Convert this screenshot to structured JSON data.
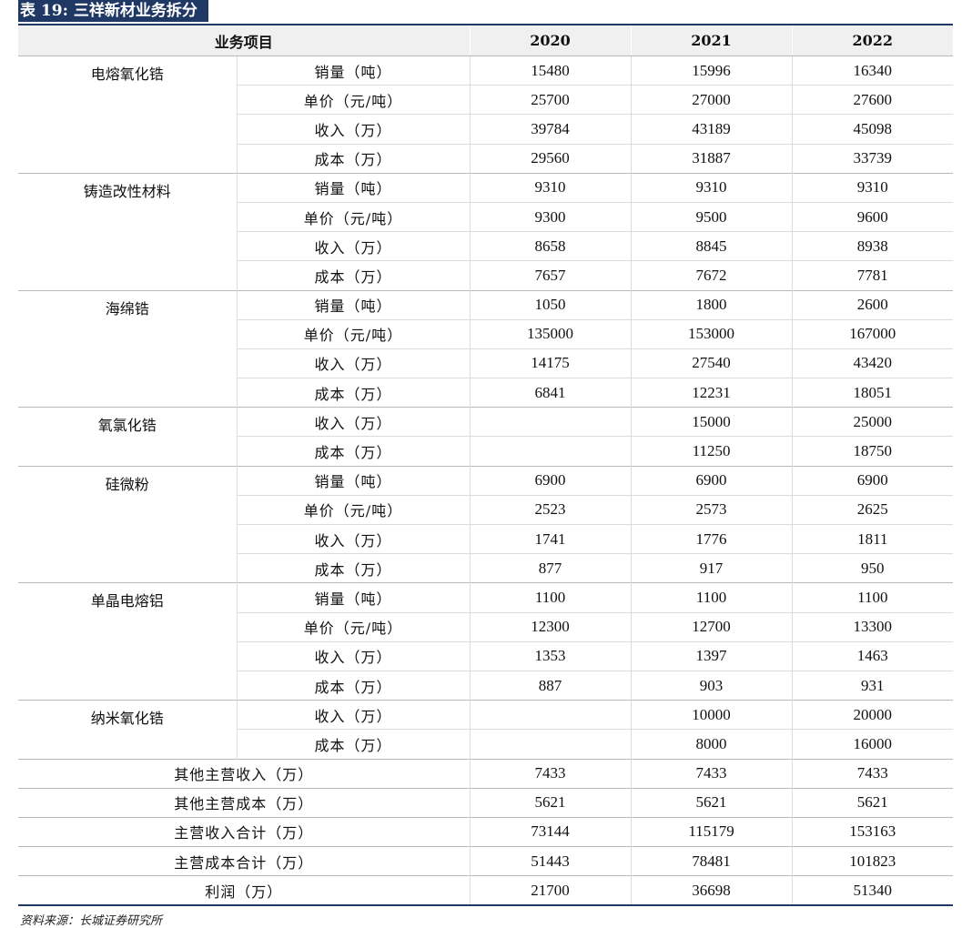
{
  "title": {
    "label": "表 19:",
    "text": "三祥新材业务拆分"
  },
  "header": [
    "业务项目",
    "2020",
    "2021",
    "2022"
  ],
  "groups": [
    {
      "name": "电熔氧化锆",
      "rows": [
        {
          "metric": "销量（吨）",
          "values": [
            "15480",
            "15996",
            "16340"
          ]
        },
        {
          "metric": "单价（元/吨）",
          "values": [
            "25700",
            "27000",
            "27600"
          ]
        },
        {
          "metric": "收入（万）",
          "values": [
            "39784",
            "43189",
            "45098"
          ]
        },
        {
          "metric": "成本（万）",
          "values": [
            "29560",
            "31887",
            "33739"
          ]
        }
      ]
    },
    {
      "name": "铸造改性材料",
      "rows": [
        {
          "metric": "销量（吨）",
          "values": [
            "9310",
            "9310",
            "9310"
          ]
        },
        {
          "metric": "单价（元/吨）",
          "values": [
            "9300",
            "9500",
            "9600"
          ]
        },
        {
          "metric": "收入（万）",
          "values": [
            "8658",
            "8845",
            "8938"
          ]
        },
        {
          "metric": "成本（万）",
          "values": [
            "7657",
            "7672",
            "7781"
          ]
        }
      ]
    },
    {
      "name": "海绵锆",
      "rows": [
        {
          "metric": "销量（吨）",
          "values": [
            "1050",
            "1800",
            "2600"
          ]
        },
        {
          "metric": "单价（元/吨）",
          "values": [
            "135000",
            "153000",
            "167000"
          ]
        },
        {
          "metric": "收入（万）",
          "values": [
            "14175",
            "27540",
            "43420"
          ]
        },
        {
          "metric": "成本（万）",
          "values": [
            "6841",
            "12231",
            "18051"
          ]
        }
      ]
    },
    {
      "name": "氧氯化锆",
      "rows": [
        {
          "metric": "收入（万）",
          "values": [
            "",
            "15000",
            "25000"
          ]
        },
        {
          "metric": "成本（万）",
          "values": [
            "",
            "11250",
            "18750"
          ]
        }
      ]
    },
    {
      "name": "硅微粉",
      "rows": [
        {
          "metric": "销量（吨）",
          "values": [
            "6900",
            "6900",
            "6900"
          ]
        },
        {
          "metric": "单价（元/吨）",
          "values": [
            "2523",
            "2573",
            "2625"
          ]
        },
        {
          "metric": "收入（万）",
          "values": [
            "1741",
            "1776",
            "1811"
          ]
        },
        {
          "metric": "成本（万）",
          "values": [
            "877",
            "917",
            "950"
          ]
        }
      ]
    },
    {
      "name": "单晶电熔铝",
      "rows": [
        {
          "metric": "销量（吨）",
          "values": [
            "1100",
            "1100",
            "1100"
          ]
        },
        {
          "metric": "单价（元/吨）",
          "values": [
            "12300",
            "12700",
            "13300"
          ]
        },
        {
          "metric": "收入（万）",
          "values": [
            "1353",
            "1397",
            "1463"
          ]
        },
        {
          "metric": "成本（万）",
          "values": [
            "887",
            "903",
            "931"
          ]
        }
      ]
    },
    {
      "name": "纳米氧化锆",
      "rows": [
        {
          "metric": "收入（万）",
          "values": [
            "",
            "10000",
            "20000"
          ]
        },
        {
          "metric": "成本（万）",
          "values": [
            "",
            "8000",
            "16000"
          ]
        }
      ]
    }
  ],
  "summary": [
    {
      "label": "其他主营收入（万）",
      "values": [
        "7433",
        "7433",
        "7433"
      ]
    },
    {
      "label": "其他主营成本（万）",
      "values": [
        "5621",
        "5621",
        "5621"
      ]
    },
    {
      "label": "主营收入合计（万）",
      "values": [
        "73144",
        "115179",
        "153163"
      ]
    },
    {
      "label": "主营成本合计（万）",
      "values": [
        "51443",
        "78481",
        "101823"
      ]
    },
    {
      "label": "利润（万）",
      "values": [
        "21700",
        "36698",
        "51340"
      ]
    }
  ],
  "source": "资料来源：长城证券研究所",
  "colors": {
    "accent": "#1f3864",
    "header_bg": "#f0f0f0"
  }
}
